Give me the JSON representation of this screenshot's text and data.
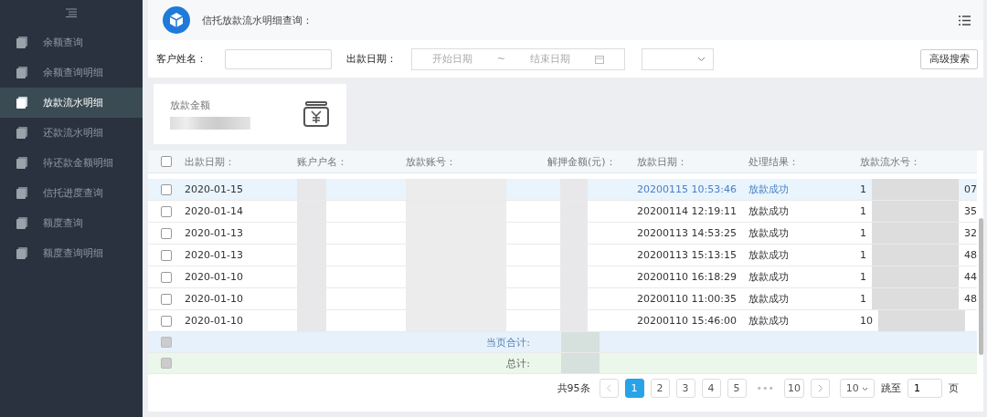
{
  "sidebar": {
    "items": [
      {
        "label": "余额查询",
        "selected": false
      },
      {
        "label": "余额查询明细",
        "selected": false
      },
      {
        "label": "放款流水明细",
        "selected": true
      },
      {
        "label": "还款流水明细",
        "selected": false
      },
      {
        "label": "待还款金额明细",
        "selected": false
      },
      {
        "label": "信托进度查询",
        "selected": false
      },
      {
        "label": "额度查询",
        "selected": false
      },
      {
        "label": "额度查询明细",
        "selected": false
      }
    ]
  },
  "header": {
    "title": "信托放款流水明细查询："
  },
  "filters": {
    "name_label": "客户姓名：",
    "date_label": "出款日期：",
    "start_placeholder": "开始日期",
    "separator": "~",
    "end_placeholder": "结束日期",
    "search_button": "高级搜索"
  },
  "summary": {
    "label": "放款金额"
  },
  "table": {
    "columns": [
      "出款日期：",
      "账户户名：",
      "放款账号：",
      "解押金额(元)：",
      "放款日期：",
      "处理结果：",
      "放款流水号："
    ],
    "rows": [
      {
        "date": "2020-01-15",
        "time": "20200115 10:53:46",
        "result": "放款成功",
        "serial_prefix": "1",
        "serial_suffix": "07",
        "selected": true,
        "checked": false
      },
      {
        "date": "2020-01-14",
        "time": "20200114 12:19:11",
        "result": "放款成功",
        "serial_prefix": "1",
        "serial_suffix": "35",
        "selected": false,
        "checked": false
      },
      {
        "date": "2020-01-13",
        "time": "20200113 14:53:25",
        "result": "放款成功",
        "serial_prefix": "1",
        "serial_suffix": "32",
        "selected": false,
        "checked": false
      },
      {
        "date": "2020-01-13",
        "time": "20200113 15:13:15",
        "result": "放款成功",
        "serial_prefix": "1",
        "serial_suffix": "48",
        "selected": false,
        "checked": false
      },
      {
        "date": "2020-01-10",
        "time": "20200110 16:18:29",
        "result": "放款成功",
        "serial_prefix": "1",
        "serial_suffix": "44",
        "selected": false,
        "checked": false
      },
      {
        "date": "2020-01-10",
        "time": "20200110 11:00:35",
        "result": "放款成功",
        "serial_prefix": "1",
        "serial_suffix": "48",
        "selected": false,
        "checked": false
      },
      {
        "date": "2020-01-10",
        "time": "20200110 15:46:00",
        "result": "放款成功",
        "serial_prefix": "10",
        "selected": false,
        "checked": false
      }
    ],
    "header_checked": false,
    "totals_disabled": true,
    "page_total_label": "当页合计:",
    "grand_total_label": "总计:"
  },
  "pagination": {
    "total": "共95条",
    "pages": [
      {
        "label": "1",
        "selected": true
      },
      {
        "label": "2",
        "selected": false
      },
      {
        "label": "3",
        "selected": false
      },
      {
        "label": "4",
        "selected": false
      },
      {
        "label": "5",
        "selected": false
      }
    ],
    "ellipsis": "•••",
    "last": "10",
    "page_size": "10",
    "jump_label": "跳至",
    "jump_value": "1",
    "page_unit": "页"
  }
}
